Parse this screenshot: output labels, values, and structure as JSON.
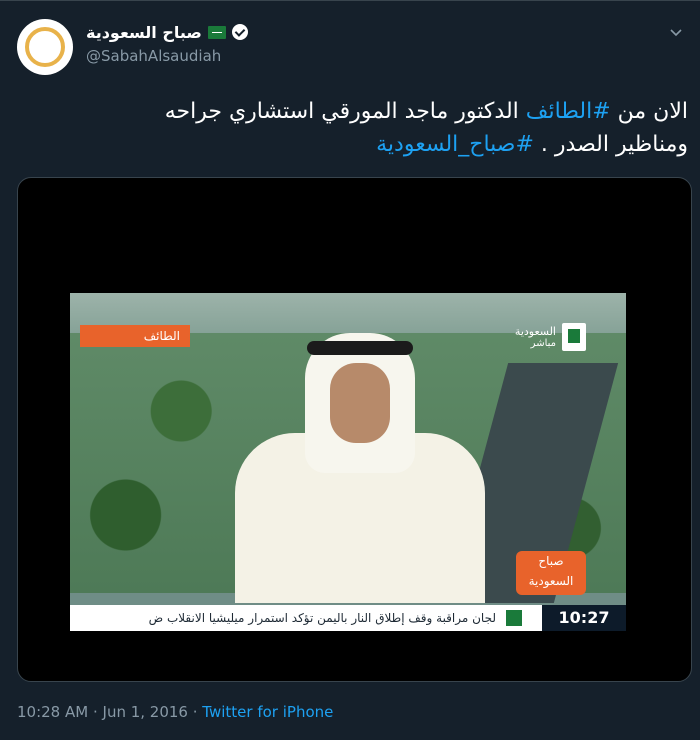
{
  "tweet": {
    "display_name": "صباح السعودية",
    "handle": "@SabahAlsaudiah",
    "text_line1_prefix": "الان من ",
    "hashtag1": "#الطائف",
    "text_line1_suffix": " الدكتور ماجد المورقي استشاري جراحه",
    "text_line2_prefix": "ومناظير الصدر . ",
    "hashtag2": "#صباح_السعودية",
    "time": "10:28 AM",
    "date_sep": " · ",
    "date": "Jun 1, 2016",
    "source": "Twitter for iPhone"
  },
  "media": {
    "location_tag": "الطائف",
    "channel_name": "السعودية",
    "channel_live": "مباشر",
    "show_logo_line1": "صباح",
    "show_logo_line2": "السعودية",
    "ticker_text": "لجان مراقبة وقف إطلاق النار باليمن تؤكد استمرار ميليشيا الانقلاب ض",
    "clock": "10:27"
  },
  "colors": {
    "background": "#15202b",
    "link": "#1da1f2",
    "muted": "#8899a6",
    "avatar_ring": "#e8b24a"
  },
  "icons": [
    "verified-badge-icon",
    "saudi-flag-icon",
    "chevron-down-icon"
  ]
}
